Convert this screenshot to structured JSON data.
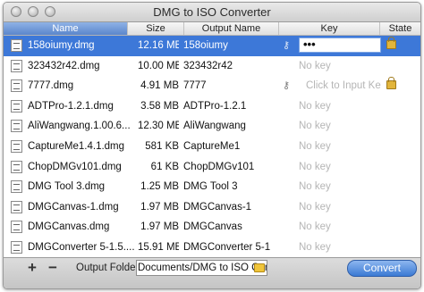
{
  "window": {
    "title": "DMG to ISO Converter"
  },
  "columns": {
    "name": "Name",
    "size": "Size",
    "output": "Output Name",
    "key": "Key",
    "state": "State"
  },
  "rows": [
    {
      "name": "158oiumy.dmg",
      "size": "12.16 MB",
      "output": "158oiumy",
      "key": "•••",
      "selected": true
    },
    {
      "name": "323432r42.dmg",
      "size": "10.00 MB",
      "output": "323432r42",
      "key": "No key"
    },
    {
      "name": "7777.dmg",
      "size": "4.91 MB",
      "output": "7777",
      "key": "Click to Input Key"
    },
    {
      "name": "ADTPro-1.2.1.dmg",
      "size": "3.58 MB",
      "output": "ADTPro-1.2.1",
      "key": "No key"
    },
    {
      "name": "AliWangwang.1.00.6...",
      "size": "12.30 MB",
      "output": "AliWangwang",
      "key": "No key"
    },
    {
      "name": "CaptureMe1.4.1.dmg",
      "size": "581 KB",
      "output": "CaptureMe1",
      "key": "No key"
    },
    {
      "name": "ChopDMGv101.dmg",
      "size": "61 KB",
      "output": "ChopDMGv101",
      "key": "No key"
    },
    {
      "name": "DMG Tool 3.dmg",
      "size": "1.25 MB",
      "output": "DMG Tool 3",
      "key": "No key"
    },
    {
      "name": "DMGCanvas-1.dmg",
      "size": "1.97 MB",
      "output": "DMGCanvas-1",
      "key": "No key"
    },
    {
      "name": "DMGCanvas.dmg",
      "size": "1.97 MB",
      "output": "DMGCanvas",
      "key": "No key"
    },
    {
      "name": "DMGConverter 5-1.5....",
      "size": "15.91 MB",
      "output": "DMGConverter 5-1",
      "key": "No key"
    }
  ],
  "bottom": {
    "add": "+",
    "remove": "−",
    "output_label": "Output Folder:",
    "output_path": "Documents/DMG to ISO Conver",
    "convert": "Convert"
  }
}
